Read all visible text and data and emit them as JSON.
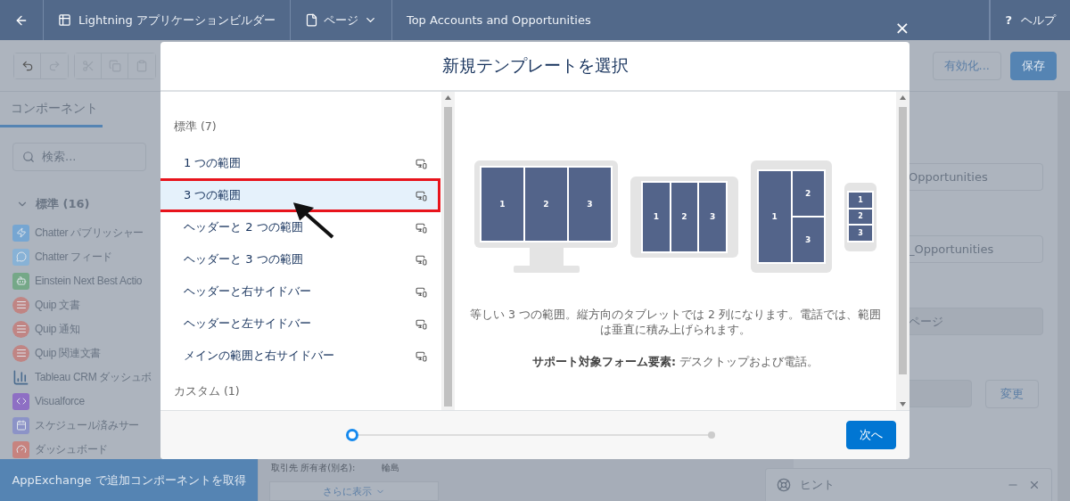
{
  "header": {
    "app_title": "Lightning アプリケーションビルダー",
    "page_menu": "ページ",
    "page_name": "Top Accounts and Opportunities",
    "help_mark": "?",
    "help": "ヘルプ"
  },
  "toolbar": {
    "activate": "有効化...",
    "save": "保存"
  },
  "left_panel": {
    "tab": {
      "label": "コンポーネント",
      "selected": true
    },
    "search": {
      "placeholder": "検索..."
    },
    "group": {
      "label": "標準 (16)",
      "expanded": true
    },
    "items": [
      {
        "label": "Chatter パブリッシャー",
        "kind": "bolt",
        "color": "#76a6d2"
      },
      {
        "label": "Chatter フィード",
        "kind": "chat",
        "color": "#88b2d6"
      },
      {
        "label": "Einstein Next Best Actio",
        "kind": "einstein",
        "color": "#75a888"
      },
      {
        "label": "Quip 文書",
        "kind": "quip",
        "color": "#c08584"
      },
      {
        "label": "Quip 通知",
        "kind": "quip",
        "color": "#c08584"
      },
      {
        "label": "Quip 関連文書",
        "kind": "quip",
        "color": "#c08584"
      },
      {
        "label": "Tableau CRM ダッシュボ",
        "kind": "chart"
      },
      {
        "label": "Visualforce",
        "kind": "code",
        "color": "#8e6fc4"
      },
      {
        "label": "スケジュール済みサー",
        "kind": "calendar",
        "color": "#8c93c7"
      },
      {
        "label": "ダッシュボード",
        "kind": "gauge",
        "color": "#c7837f"
      }
    ],
    "appexchange": "AppExchange で追加コンポーネントを取得"
  },
  "canvas": {
    "owner_label": "取引先 所有者(別名):",
    "owner_value": "輪島",
    "more": "さらに表示"
  },
  "right_panel": {
    "fields": [
      {
        "value": "Opportunities"
      },
      {
        "value": "_Opportunities"
      }
    ],
    "page_type": "ページ",
    "change": "変更"
  },
  "hint": {
    "title": "ヒント"
  },
  "modal": {
    "title": "新規テンプレートを選択",
    "close": "×",
    "sections": [
      {
        "label": "標準 (7)",
        "items": [
          {
            "label": "1 つの範囲",
            "selected": false
          },
          {
            "label": "3 つの範囲",
            "selected": true
          },
          {
            "label": "ヘッダーと 2 つの範囲",
            "selected": false
          },
          {
            "label": "ヘッダーと 3 つの範囲",
            "selected": false
          },
          {
            "label": "ヘッダーと右サイドバー",
            "selected": false
          },
          {
            "label": "ヘッダーと左サイドバー",
            "selected": false
          },
          {
            "label": "メインの範囲と右サイドバー",
            "selected": false
          }
        ]
      },
      {
        "label": "カスタム (1)"
      }
    ],
    "preview": {
      "devices": [
        {
          "kind": "desktop",
          "regions": [
            "1",
            "2",
            "3"
          ]
        },
        {
          "kind": "tablet-landscape",
          "regions": [
            "1",
            "2",
            "3"
          ]
        },
        {
          "kind": "tablet-portrait",
          "regions": [
            "1",
            "2",
            "3"
          ]
        },
        {
          "kind": "phone",
          "regions": [
            "1",
            "2",
            "3"
          ]
        }
      ],
      "description": "等しい 3 つの範囲。縦方向のタブレットでは 2 列になります。電話では、範囲は垂直に積み上げられます。",
      "support": "**サポート対象フォーム要素:** デスクトップおよび電話。"
    },
    "steps": [
      {
        "selected": true
      },
      {
        "selected": false
      }
    ],
    "next": "次へ"
  }
}
